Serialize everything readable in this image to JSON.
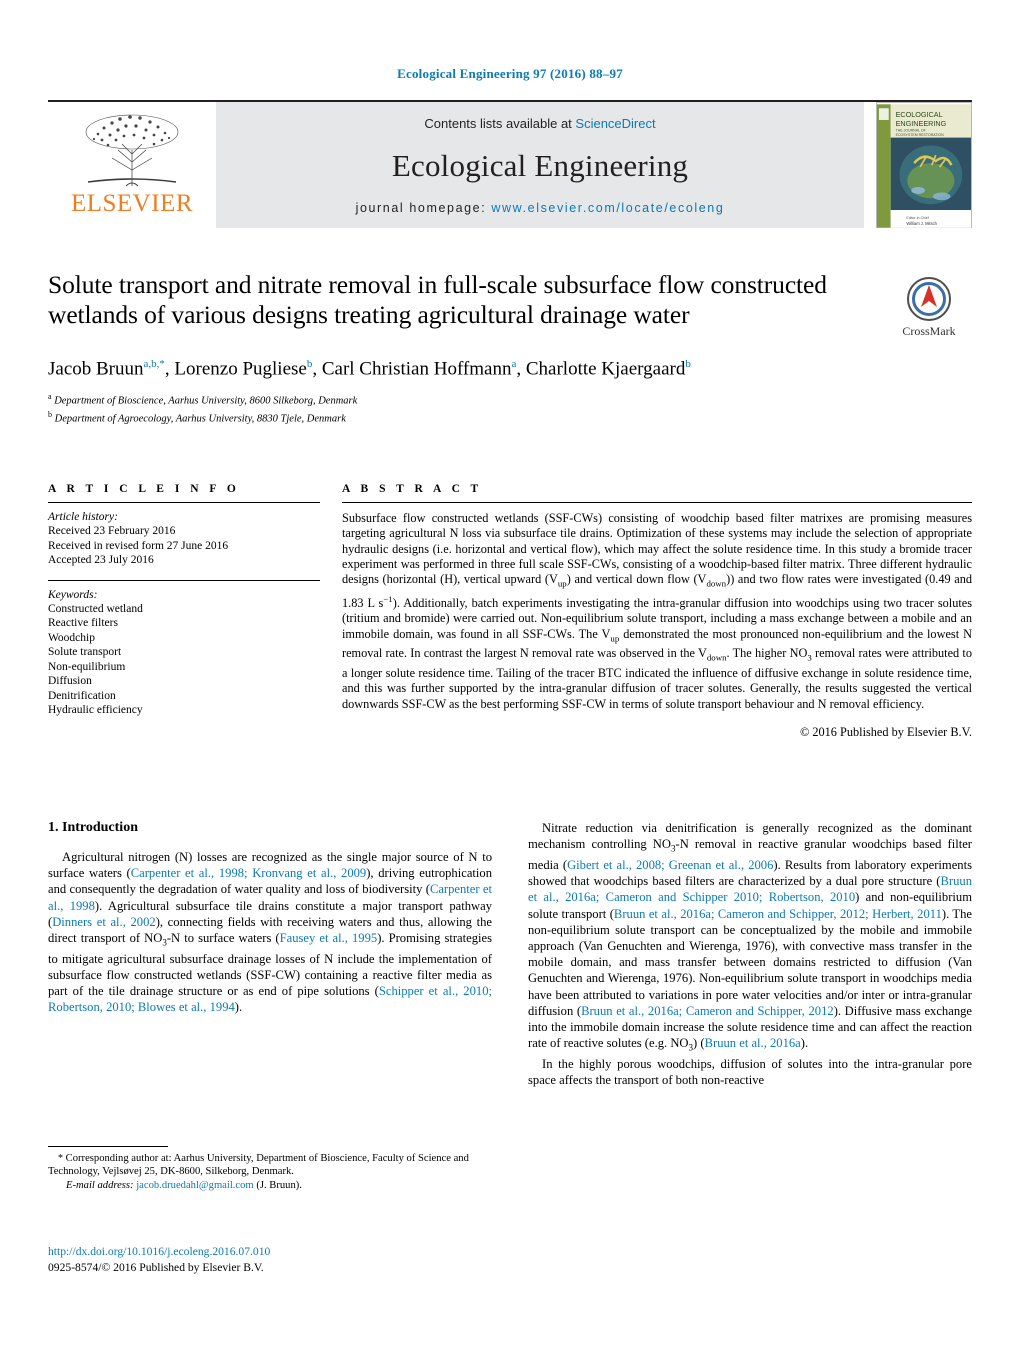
{
  "running_head": "Ecological Engineering 97 (2016) 88–97",
  "masthead": {
    "contents_prefix": "Contents lists available at ",
    "sciencedirect": "ScienceDirect",
    "journal_name": "Ecological Engineering",
    "homepage_label": "journal homepage: ",
    "homepage_url": "www.elsevier.com/locate/ecoleng",
    "publisher_wordmark": "ELSEVIER",
    "cover": {
      "line1": "ECOLOGICAL",
      "line2": "ENGINEERING",
      "line3": "THE JOURNAL OF",
      "line4": "ECOSYSTEM RESTORATION",
      "footer1": "Editor-in-Chief",
      "footer2": "William J. Mitsch"
    }
  },
  "article": {
    "title": "Solute transport and nitrate removal in full-scale subsurface flow constructed wetlands of various designs treating agricultural drainage water",
    "crossmark_label": "CrossMark",
    "authors": [
      {
        "name": "Jacob Bruun",
        "marks": "a,b,*"
      },
      {
        "name": "Lorenzo Pugliese",
        "marks": "b"
      },
      {
        "name": "Carl Christian Hoffmann",
        "marks": "a"
      },
      {
        "name": "Charlotte Kjaergaard",
        "marks": "b"
      }
    ],
    "affiliations": [
      {
        "mark": "a",
        "text": "Department of Bioscience, Aarhus University, 8600 Silkeborg, Denmark"
      },
      {
        "mark": "b",
        "text": "Department of Agroecology, Aarhus University, 8830 Tjele, Denmark"
      }
    ]
  },
  "article_info": {
    "heading": "A R T I C L E   I N F O",
    "history_label": "Article history:",
    "history": [
      "Received 23 February 2016",
      "Received in revised form 27 June 2016",
      "Accepted 23 July 2016"
    ],
    "keywords_label": "Keywords:",
    "keywords": [
      "Constructed wetland",
      "Reactive filters",
      "Woodchip",
      "Solute transport",
      "Non-equilibrium",
      "Diffusion",
      "Denitrification",
      "Hydraulic efficiency"
    ]
  },
  "abstract": {
    "heading": "A B S T R A C T",
    "text": "Subsurface flow constructed wetlands (SSF-CWs) consisting of woodchip based filter matrixes are promising measures targeting agricultural N loss via subsurface tile drains. Optimization of these systems may include the selection of appropriate hydraulic designs (i.e. horizontal and vertical flow), which may affect the solute residence time. In this study a bromide tracer experiment was performed in three full scale SSF-CWs, consisting of a woodchip-based filter matrix. Three different hydraulic designs (horizontal (H), vertical upward (Vup) and vertical down flow (Vdown)) and two flow rates were investigated (0.49 and 1.83 L s−1). Additionally, batch experiments investigating the intra-granular diffusion into woodchips using two tracer solutes (tritium and bromide) were carried out. Non-equilibrium solute transport, including a mass exchange between a mobile and an immobile domain, was found in all SSF-CWs. The Vup demonstrated the most pronounced non-equilibrium and the lowest N removal rate. In contrast the largest N removal rate was observed in the Vdown. The higher NO3 removal rates were attributed to a longer solute residence time. Tailing of the tracer BTC indicated the influence of diffusive exchange in solute residence time, and this was further supported by the intra-granular diffusion of tracer solutes. Generally, the results suggested the vertical downwards SSF-CW as the best performing SSF-CW in terms of solute transport behaviour and N removal efficiency.",
    "copyright": "© 2016 Published by Elsevier B.V."
  },
  "introduction": {
    "heading": "1.  Introduction",
    "left_paragraph": "Agricultural nitrogen (N) losses are recognized as the single major source of N to surface waters (Carpenter et al., 1998; Kronvang et al., 2009), driving eutrophication and consequently the degradation of water quality and loss of biodiversity (Carpenter et al., 1998). Agricultural subsurface tile drains constitute a major transport pathway (Dinners et al., 2002), connecting fields with receiving waters and thus, allowing the direct transport of NO3-N to surface waters (Fausey et al., 1995). Promising strategies to mitigate agricultural subsurface drainage losses of N include the implementation of subsurface flow constructed wetlands (SSF-CW) containing a reactive filter media as part of the tile drainage structure or as end of pipe solutions (Schipper et al., 2010; Robertson, 2010; Blowes et al., 1994).",
    "right_paragraph_1": "Nitrate reduction via denitrification is generally recognized as the dominant mechanism controlling NO3-N removal in reactive granular woodchips based filter media (Gibert et al., 2008; Greenan et al., 2006). Results from laboratory experiments showed that woodchips based filters are characterized by a dual pore structure (Bruun et al., 2016a; Cameron and Schipper 2010; Robertson, 2010) and non-equilibrium solute transport (Bruun et al., 2016a; Cameron and Schipper, 2012; Herbert, 2011). The non-equilibrium solute transport can be conceptualized by the mobile and immobile approach (Van Genuchten and Wierenga, 1976), with convective mass transfer in the mobile domain, and mass transfer between domains restricted to diffusion (Van Genuchten and Wierenga, 1976). Non-equilibrium solute transport in woodchips media have been attributed to variations in pore water velocities and/or inter or intra-granular diffusion (Bruun et al., 2016a; Cameron and Schipper, 2012). Diffusive mass exchange into the immobile domain increase the solute residence time and can affect the reaction rate of reactive solutes (e.g. NO3) (Bruun et al., 2016a).",
    "right_paragraph_2": "In the highly porous woodchips, diffusion of solutes into the intra-granular pore space affects the transport of both non-reactive"
  },
  "footnotes": {
    "corresponding": "Corresponding author at: Aarhus University, Department of Bioscience, Faculty of Science and Technology, Vejlsøvej 25, DK-8600, Silkeborg, Denmark.",
    "email_label": "E-mail address:",
    "email": "jacob.druedahl@gmail.com",
    "email_suffix": "(J. Bruun).",
    "doi": "http://dx.doi.org/10.1016/j.ecoleng.2016.07.010",
    "issn_line": "0925-8574/© 2016 Published by Elsevier B.V."
  },
  "colors": {
    "link": "#0b7ab5",
    "elsevier_orange": "#ef7d22",
    "mast_bg": "#e6e7e8"
  }
}
